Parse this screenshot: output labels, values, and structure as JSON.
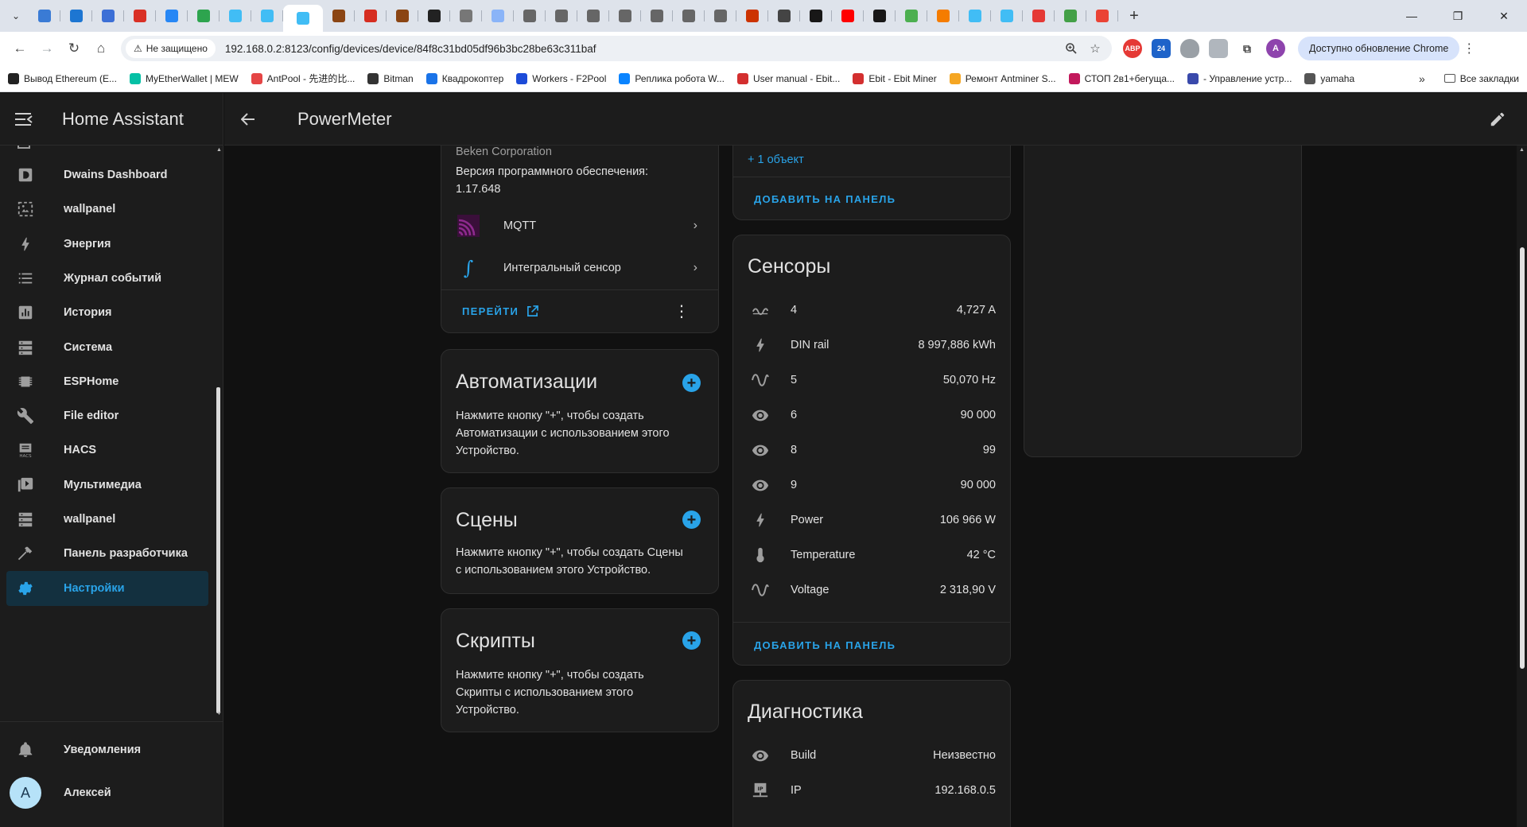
{
  "browser": {
    "tabs": [
      {
        "name": "tab-1",
        "color": "#3a7bd5"
      },
      {
        "name": "tab-2",
        "color": "#1d76d2"
      },
      {
        "name": "tab-3",
        "color": "#3c6fd6"
      },
      {
        "name": "tab-4",
        "color": "#d93025"
      },
      {
        "name": "tab-5",
        "color": "#2787f5"
      },
      {
        "name": "tab-6",
        "color": "#2da44e"
      },
      {
        "name": "tab-7",
        "color": "#41bdf5"
      },
      {
        "name": "tab-8",
        "color": "#41bdf5"
      },
      {
        "name": "tab-9",
        "color": "#41bdf5"
      },
      {
        "name": "tab-10",
        "color": "#8b4513"
      },
      {
        "name": "tab-11",
        "color": "#d62d20"
      },
      {
        "name": "tab-12",
        "color": "#8b4513"
      },
      {
        "name": "tab-13",
        "color": "#222222"
      },
      {
        "name": "tab-14",
        "color": "#777777"
      },
      {
        "name": "tab-15",
        "color": "#8ab4f8"
      },
      {
        "name": "tab-16",
        "color": "#666666"
      },
      {
        "name": "tab-17",
        "color": "#666666"
      },
      {
        "name": "tab-18",
        "color": "#666666"
      },
      {
        "name": "tab-19",
        "color": "#666666"
      },
      {
        "name": "tab-20",
        "color": "#666666"
      },
      {
        "name": "tab-21",
        "color": "#666666"
      },
      {
        "name": "tab-22",
        "color": "#666666"
      },
      {
        "name": "tab-23",
        "color": "#cc3300"
      },
      {
        "name": "tab-24",
        "color": "#444444"
      },
      {
        "name": "tab-25",
        "color": "#181717"
      },
      {
        "name": "tab-26",
        "color": "#ff0000"
      },
      {
        "name": "tab-27",
        "color": "#181717"
      },
      {
        "name": "tab-28",
        "color": "#4caf50"
      },
      {
        "name": "tab-29",
        "color": "#f57c00"
      },
      {
        "name": "tab-30",
        "color": "#41bdf5"
      },
      {
        "name": "tab-31",
        "color": "#41bdf5"
      },
      {
        "name": "tab-32",
        "color": "#e53935"
      },
      {
        "name": "tab-33",
        "color": "#43a047"
      },
      {
        "name": "tab-34",
        "color": "#ea4335"
      }
    ],
    "active_tab_index": 8,
    "security_label": "Не защищено",
    "url": "192.168.0.2:8123/config/devices/device/84f8c31bd05df96b3bc28be63c311baf",
    "profile_initial": "A",
    "update_label": "Доступно обновление Chrome",
    "bookmarks": [
      {
        "label": "Вывод Ethereum (E...",
        "color": "#222222"
      },
      {
        "label": "MyEtherWallet | MEW",
        "color": "#05c0a5"
      },
      {
        "label": "AntPool - 先进的比...",
        "color": "#e54545"
      },
      {
        "label": "Bitman",
        "color": "#333333"
      },
      {
        "label": "Квадрокоптер",
        "color": "#1a73e8"
      },
      {
        "label": "Workers - F2Pool",
        "color": "#1c4bd8"
      },
      {
        "label": "Реплика робота W...",
        "color": "#0a84ff"
      },
      {
        "label": "User manual - Ebit...",
        "color": "#d32f2f"
      },
      {
        "label": "Ebit - Ebit Miner",
        "color": "#d32f2f"
      },
      {
        "label": "Ремонт Antminer S...",
        "color": "#f5a623"
      },
      {
        "label": "СТОП 2в1+бегуща...",
        "color": "#c2185b"
      },
      {
        "label": "- Управление устр...",
        "color": "#3949ab"
      },
      {
        "label": "yamaha",
        "color": "#555555"
      }
    ],
    "all_bookmarks_label": "Все закладки"
  },
  "app": {
    "title": "Home Assistant",
    "page_title": "PowerMeter",
    "accent": "#29a3e8"
  },
  "sidebar": {
    "items": [
      {
        "label": "Dwains Dashboard",
        "icon": "dwains-icon"
      },
      {
        "label": "wallpanel",
        "icon": "image-frame-icon"
      },
      {
        "label": "Энергия",
        "icon": "lightning-icon"
      },
      {
        "label": "Журнал событий",
        "icon": "list-icon"
      },
      {
        "label": "История",
        "icon": "chart-box-icon"
      },
      {
        "label": "Система",
        "icon": "server-icon"
      },
      {
        "label": "ESPHome",
        "icon": "chip-icon"
      },
      {
        "label": "File editor",
        "icon": "wrench-icon"
      },
      {
        "label": "HACS",
        "icon": "hacs-icon"
      },
      {
        "label": "Мультимедиа",
        "icon": "play-box-icon"
      },
      {
        "label": "wallpanel",
        "icon": "server-icon"
      },
      {
        "label": "Панель разработчика",
        "icon": "hammer-icon"
      },
      {
        "label": "Настройки",
        "icon": "gear-icon",
        "active": true
      }
    ],
    "notifications_label": "Уведомления",
    "user_label": "Алексей",
    "user_initial": "A"
  },
  "device_info": {
    "manufacturer": "Beken Corporation",
    "firmware_label": "Версия программного обеспечения:",
    "firmware_version": "1.17.648",
    "integrations": [
      {
        "label": "MQTT",
        "icon": "mqtt-icon"
      },
      {
        "label": "Интегральный сенсор",
        "icon": "integral-icon"
      }
    ],
    "visit_label": "ПЕРЕЙТИ"
  },
  "automations": {
    "title": "Автоматизации",
    "hint": "Нажмите кнопку \"+\", чтобы создать Автоматизации с использованием этого Устройство."
  },
  "scenes": {
    "title": "Сцены",
    "hint": "Нажмите кнопку \"+\", чтобы создать Сцены с использованием этого Устройство."
  },
  "scripts": {
    "title": "Скрипты",
    "hint": "Нажмите кнопку \"+\", чтобы создать Скрипты с использованием этого Устройство."
  },
  "controls_card": {
    "more_label": "+ 1 объект",
    "add_label": "ДОБАВИТЬ НА ПАНЕЛЬ"
  },
  "sensors": {
    "title": "Сенсоры",
    "rows": [
      {
        "name": "4",
        "value": "4,727 A",
        "icon": "current-ac-icon"
      },
      {
        "name": "DIN rail",
        "value": "8 997,886 kWh",
        "icon": "lightning-icon"
      },
      {
        "name": "5",
        "value": "50,070 Hz",
        "icon": "sine-wave-icon"
      },
      {
        "name": "6",
        "value": "90 000",
        "icon": "eye-icon"
      },
      {
        "name": "8",
        "value": "99",
        "icon": "eye-icon"
      },
      {
        "name": "9",
        "value": "90 000",
        "icon": "eye-icon"
      },
      {
        "name": "Power",
        "value": "106 966 W",
        "icon": "lightning-icon"
      },
      {
        "name": "Temperature",
        "value": "42 °C",
        "icon": "thermometer-icon"
      },
      {
        "name": "Voltage",
        "value": "2 318,90 V",
        "icon": "sine-wave-icon"
      }
    ],
    "add_label": "ДОБАВИТЬ НА ПАНЕЛЬ"
  },
  "diagnostics": {
    "title": "Диагностика",
    "rows": [
      {
        "name": "Build",
        "value": "Неизвестно",
        "icon": "eye-icon"
      },
      {
        "name": "IP",
        "value": "192.168.0.5",
        "icon": "ip-network-icon"
      }
    ]
  }
}
